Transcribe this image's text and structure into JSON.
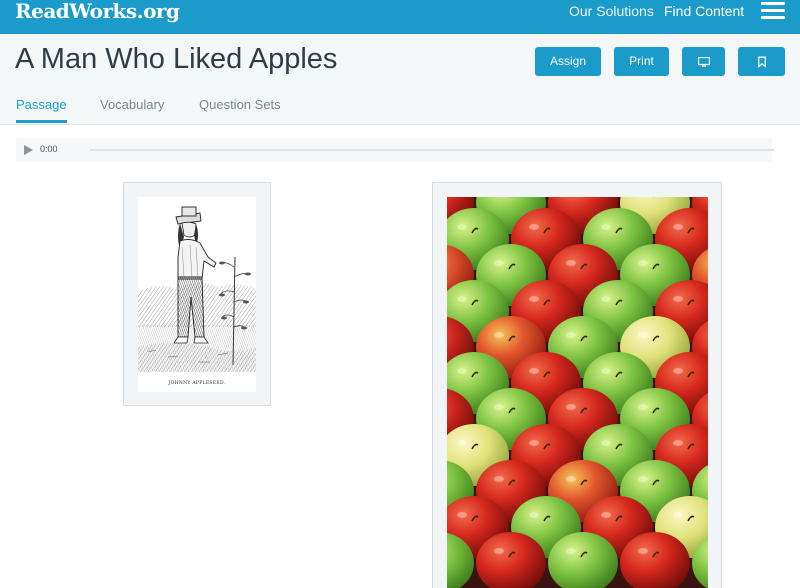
{
  "nav": {
    "logo": "ReadWorks.org",
    "links": [
      "Our Solutions",
      "Find Content"
    ],
    "menu_icon": "hamburger-menu-icon"
  },
  "header": {
    "title": "A Man Who Liked Apples",
    "buttons": {
      "assign": "Assign",
      "print": "Print",
      "present_icon": "monitor-icon",
      "bookmark_icon": "bookmark-icon"
    },
    "tabs": [
      {
        "label": "Passage",
        "active": true
      },
      {
        "label": "Vocabulary",
        "active": false
      },
      {
        "label": "Question Sets",
        "active": false
      }
    ]
  },
  "audio": {
    "play_icon": "play-icon",
    "time": "0:00",
    "progress": 0
  },
  "images": {
    "left": {
      "caption": "JOHNNY APPLESEED.",
      "description": "engraving"
    },
    "right": {
      "description": "photo"
    }
  },
  "colors": {
    "brand": "#1a9bc9",
    "header_bg": "#f4f7f8"
  }
}
